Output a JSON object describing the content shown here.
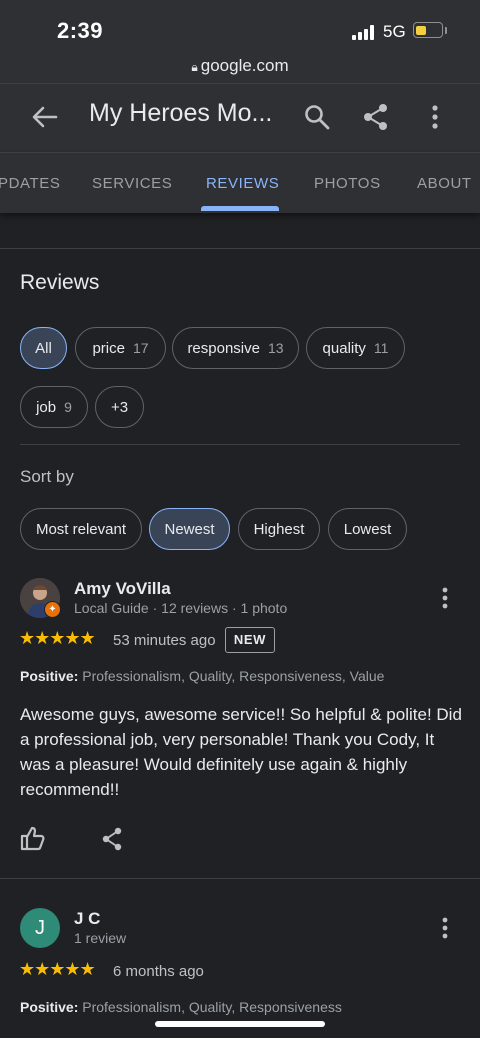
{
  "status_bar": {
    "time": "2:39",
    "network": "5G",
    "battery_level": 0.45,
    "url": "google.com"
  },
  "app_bar": {
    "title": "My Heroes Mo..."
  },
  "tabs": [
    {
      "label": "PDATES",
      "active": false
    },
    {
      "label": "SERVICES",
      "active": false
    },
    {
      "label": "REVIEWS",
      "active": true
    },
    {
      "label": "PHOTOS",
      "active": false
    },
    {
      "label": "ABOUT",
      "active": false
    }
  ],
  "reviews_heading": "Reviews",
  "topic_chips": [
    {
      "label": "All",
      "count": ""
    },
    {
      "label": "price",
      "count": "17"
    },
    {
      "label": "responsive",
      "count": "13"
    },
    {
      "label": "quality",
      "count": "11"
    },
    {
      "label": "job",
      "count": "9"
    },
    {
      "label": "+3",
      "count": ""
    }
  ],
  "sort": {
    "label": "Sort by",
    "options": [
      "Most relevant",
      "Newest",
      "Highest",
      "Lowest"
    ],
    "selected": "Newest"
  },
  "reviews": [
    {
      "name": "Amy VoVilla",
      "meta": "Local Guide · 12 reviews · 1 photo",
      "stars": "★★★★★",
      "rating": 5,
      "time": "53 minutes ago",
      "badge": "NEW",
      "positive_label": "Positive:",
      "positive": "Professionalism, Quality, Responsiveness, Value",
      "text": "Awesome guys, awesome service!! So helpful & polite! Did a professional job, very personable! Thank you Cody, It was a pleasure! Would definitely use again & highly recommend!!"
    },
    {
      "name": "J C",
      "initial": "J",
      "meta": "1 review",
      "stars": "★★★★★",
      "rating": 5,
      "time": "6 months ago",
      "positive_label": "Positive:",
      "positive": "Professionalism, Quality, Responsiveness"
    }
  ],
  "colors": {
    "accent": "#8ab4f8",
    "star": "#fbbc04",
    "background": "#202124",
    "header": "#2f3033",
    "avatar_jc": "#2e8b77"
  },
  "icons": [
    "back-arrow-icon",
    "search-icon",
    "share-icon",
    "more-vert-icon",
    "thumb-up-icon",
    "lock-icon"
  ]
}
